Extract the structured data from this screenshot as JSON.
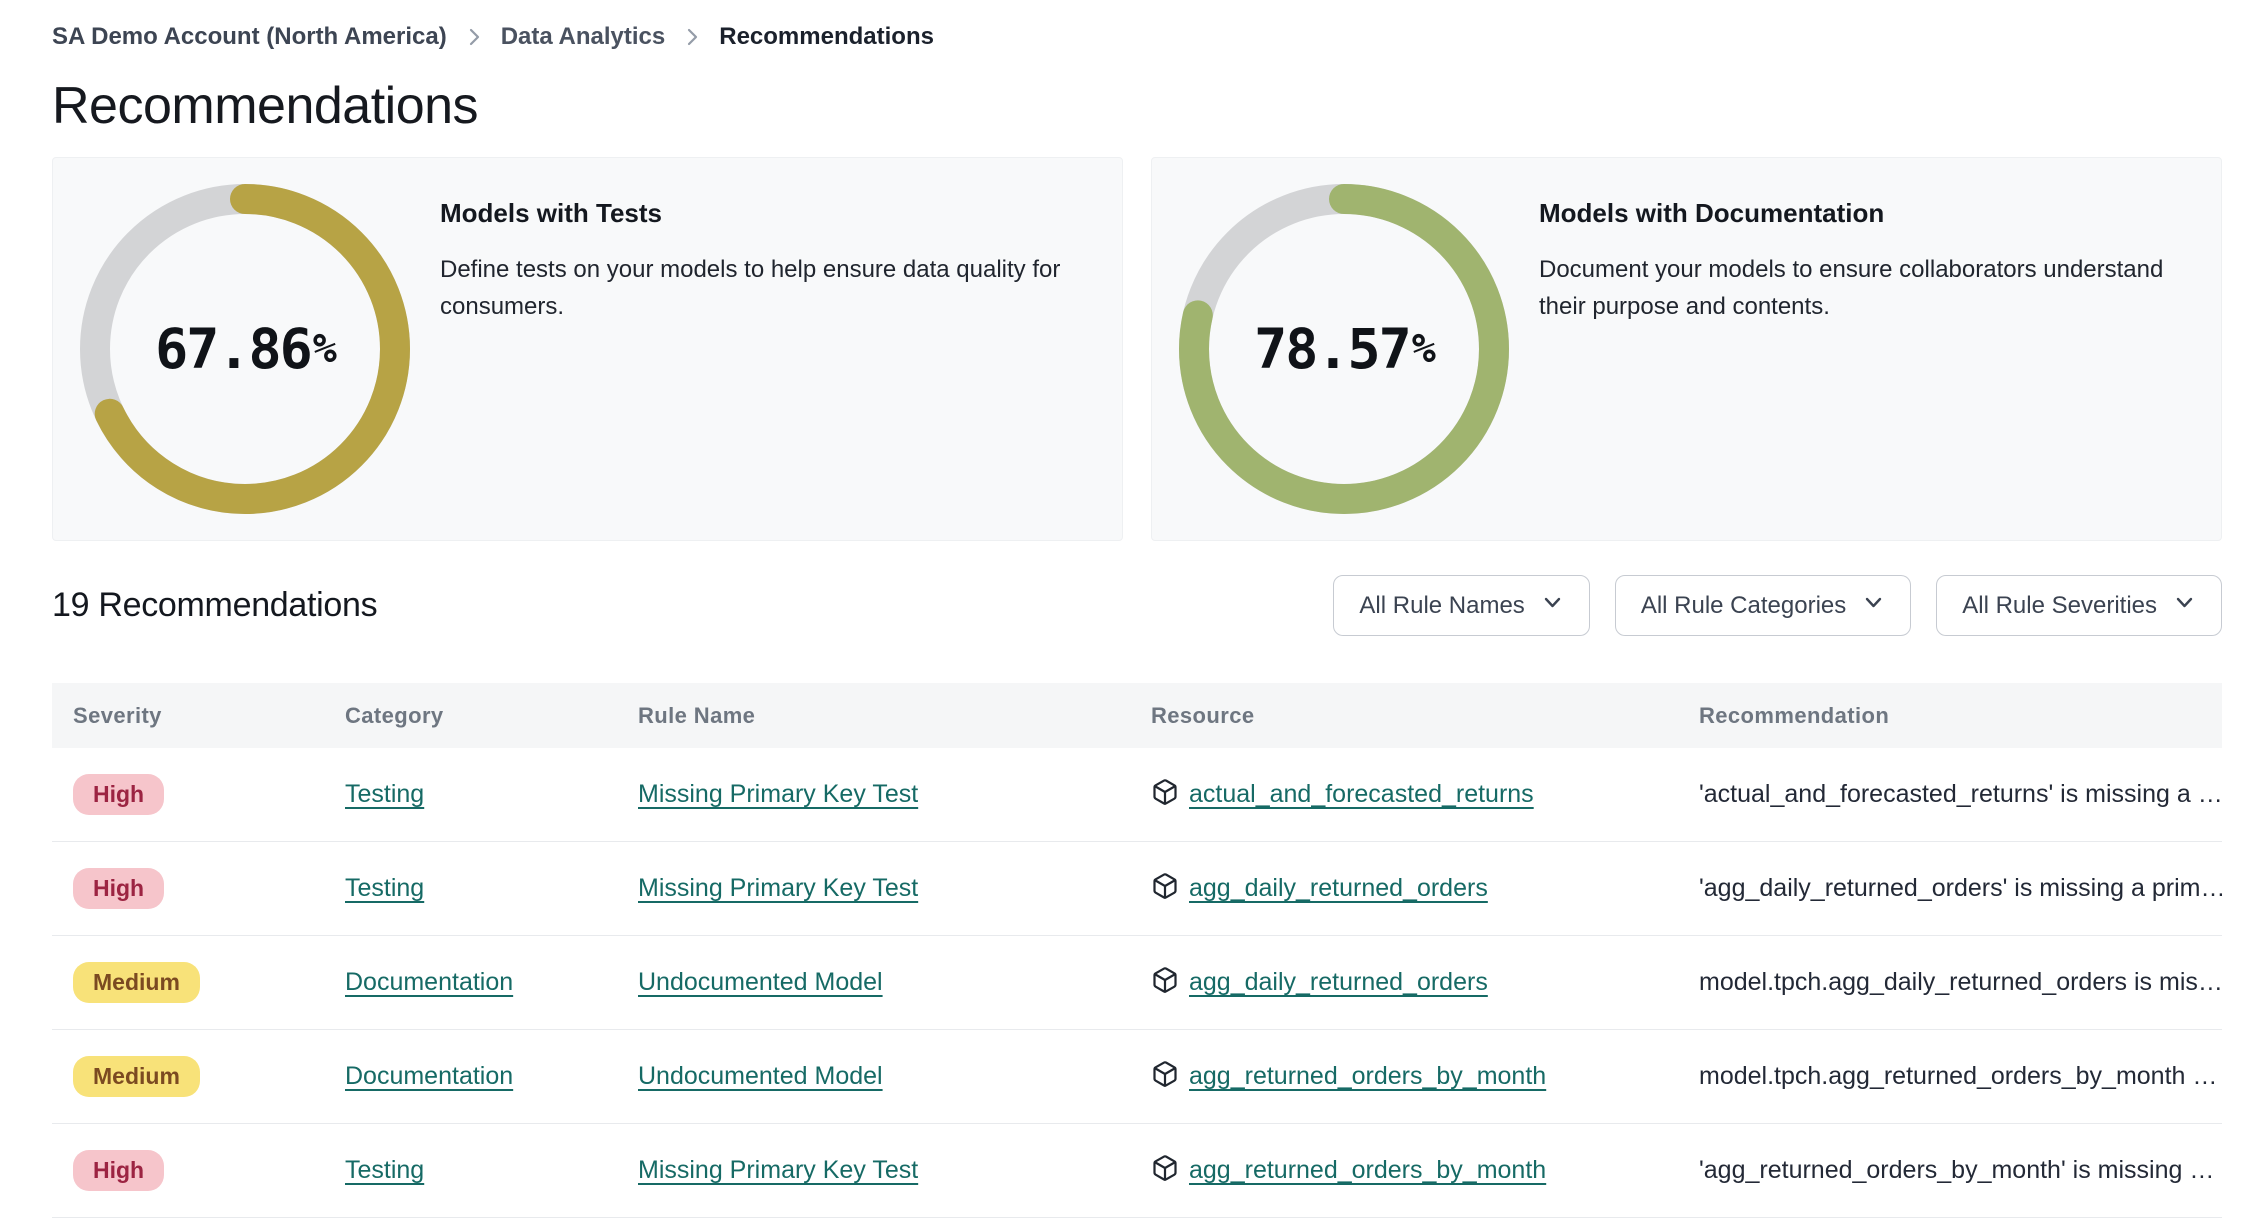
{
  "breadcrumb": {
    "items": [
      {
        "label": "SA Demo Account (North America)"
      },
      {
        "label": "Data Analytics"
      },
      {
        "label": "Recommendations"
      }
    ]
  },
  "page_title": "Recommendations",
  "summary_cards": [
    {
      "title": "Models with Tests",
      "description": "Define tests on your models to help ensure data quality for consumers.",
      "percent_value": "67.86",
      "percent_symbol": "%",
      "value": 67.86,
      "color": "#b7a345"
    },
    {
      "title": "Models with Documentation",
      "description": "Document your models to ensure collaborators understand their purpose and contents.",
      "percent_value": "78.57",
      "percent_symbol": "%",
      "value": 78.57,
      "color": "#a0b46f"
    }
  ],
  "list_toolbar": {
    "count_heading": "19 Recommendations",
    "filters": [
      {
        "label": "All Rule Names"
      },
      {
        "label": "All Rule Categories"
      },
      {
        "label": "All Rule Severities"
      }
    ]
  },
  "table": {
    "columns": [
      "Severity",
      "Category",
      "Rule Name",
      "Resource",
      "Recommendation"
    ],
    "rows": [
      {
        "severity": {
          "label": "High",
          "level": "high"
        },
        "category": "Testing",
        "rule_name": "Missing Primary Key Test",
        "resource": "actual_and_forecasted_returns",
        "recommendation": "'actual_and_forecasted_returns' is missing a …"
      },
      {
        "severity": {
          "label": "High",
          "level": "high"
        },
        "category": "Testing",
        "rule_name": "Missing Primary Key Test",
        "resource": "agg_daily_returned_orders",
        "recommendation": "'agg_daily_returned_orders' is missing a prim…"
      },
      {
        "severity": {
          "label": "Medium",
          "level": "medium"
        },
        "category": "Documentation",
        "rule_name": "Undocumented Model",
        "resource": "agg_daily_returned_orders",
        "recommendation": "model.tpch.agg_daily_returned_orders is mis…"
      },
      {
        "severity": {
          "label": "Medium",
          "level": "medium"
        },
        "category": "Documentation",
        "rule_name": "Undocumented Model",
        "resource": "agg_returned_orders_by_month",
        "recommendation": "model.tpch.agg_returned_orders_by_month …"
      },
      {
        "severity": {
          "label": "High",
          "level": "high"
        },
        "category": "Testing",
        "rule_name": "Missing Primary Key Test",
        "resource": "agg_returned_orders_by_month",
        "recommendation": "'agg_returned_orders_by_month' is missing …"
      }
    ]
  },
  "colors": {
    "tests_donut": "#b7a345",
    "docs_donut": "#a0b46f",
    "donut_track": "#d3d4d6",
    "link": "#166a65",
    "severity_high_bg": "#f6c5cb",
    "severity_high_text": "#9c2442",
    "severity_medium_bg": "#f8e279",
    "severity_medium_text": "#7b4a21",
    "table_header_bg": "#f5f6f7"
  }
}
